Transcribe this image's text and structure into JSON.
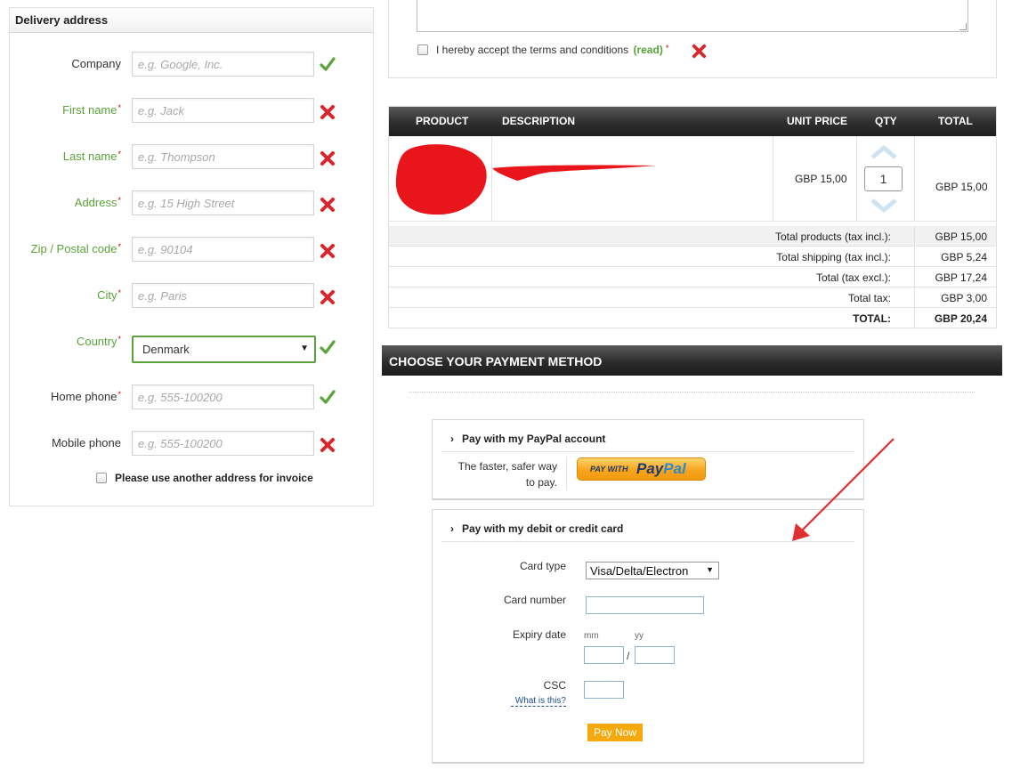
{
  "delivery": {
    "title": "Delivery address",
    "fields": [
      {
        "label": "Company",
        "placeholder": "e.g. Google, Inc.",
        "required": false,
        "status": "ok"
      },
      {
        "label": "First name",
        "placeholder": "e.g. Jack",
        "required": true,
        "status": "error"
      },
      {
        "label": "Last name",
        "placeholder": "e.g. Thompson",
        "required": true,
        "status": "error"
      },
      {
        "label": "Address",
        "placeholder": "e.g. 15 High Street",
        "required": true,
        "status": "error"
      },
      {
        "label": "Zip / Postal code",
        "placeholder": "e.g. 90104",
        "required": true,
        "status": "error"
      },
      {
        "label": "City",
        "placeholder": "e.g. Paris",
        "required": true,
        "status": "error"
      },
      {
        "label": "Country",
        "value": "Denmark",
        "required": true,
        "status": "ok"
      },
      {
        "label": "Home phone",
        "placeholder": "e.g. 555-100200",
        "required": true,
        "status": "ok"
      },
      {
        "label": "Mobile phone",
        "placeholder": "e.g. 555-100200",
        "required": false,
        "status": "error"
      }
    ],
    "required_marker": "*",
    "invoice_checkbox_label": "Please use another address for invoice"
  },
  "terms": {
    "label": "I hereby accept the terms and conditions",
    "read_link": "(read)",
    "required_marker": "*",
    "status": "error"
  },
  "cart": {
    "columns": [
      "PRODUCT",
      "DESCRIPTION",
      "UNIT PRICE",
      "QTY",
      "TOTAL"
    ],
    "item": {
      "unit_price": "GBP 15,00",
      "qty": "1",
      "total": "GBP 15,00"
    },
    "summary": [
      {
        "label": "Total products (tax incl.):",
        "value": "GBP 15,00"
      },
      {
        "label": "Total shipping (tax incl.):",
        "value": "GBP 5,24"
      },
      {
        "label": "Total (tax excl.):",
        "value": "GBP 17,24"
      },
      {
        "label": "Total tax:",
        "value": "GBP 3,00"
      },
      {
        "label": "TOTAL:",
        "value": "GBP 20,24"
      }
    ]
  },
  "payment": {
    "header": "CHOOSE YOUR PAYMENT METHOD",
    "paypal": {
      "title": "Pay with my PayPal account",
      "description_line1": "The faster, safer way",
      "description_line2": "to pay.",
      "button_pay_with": "PAY WITH",
      "button_pay": "Pay",
      "button_pal": "Pal"
    },
    "card": {
      "title": "Pay with my debit or credit card",
      "card_type_label": "Card type",
      "card_type_value": "Visa/Delta/Electron",
      "card_number_label": "Card number",
      "expiry_label": "Expiry date",
      "expiry_month_hint": "mm",
      "expiry_year_hint": "yy",
      "expiry_separator": "/",
      "csc_label": "CSC",
      "csc_help_link": "What is this?",
      "pay_now_label": "Pay Now"
    }
  },
  "colors": {
    "required_label": "#5aa33b",
    "error_icon": "#d8262b",
    "ok_icon": "#5aa33b",
    "pay_now": "#f5a90c",
    "redaction": "#e8151b",
    "annotation_arrow": "#e03030"
  }
}
